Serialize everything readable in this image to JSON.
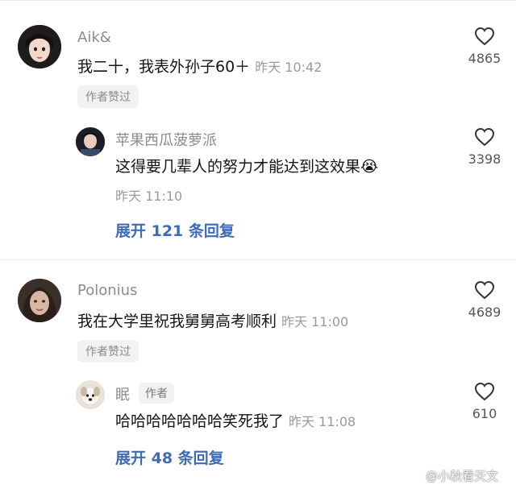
{
  "comments": [
    {
      "username": "Aik&",
      "text": "我二十，我表外孙子60＋",
      "time": "昨天 10:42",
      "author_liked": "作者赞过",
      "likes": "4865",
      "reply": {
        "username": "苹果西瓜菠萝派",
        "text": "这得要几辈人的努力才能达到这效果",
        "emoji": "😭",
        "time": "昨天 11:10",
        "likes": "3398"
      },
      "expand_label": "展开 121 条回复"
    },
    {
      "username": "Polonius",
      "text": "我在大学里祝我舅舅高考顺利",
      "time": "昨天 11:00",
      "author_liked": "作者赞过",
      "likes": "4689",
      "reply": {
        "username": "眠",
        "author_tag": "作者",
        "text": "哈哈哈哈哈哈哈笑死我了",
        "time": "昨天 11:08",
        "likes": "610"
      },
      "expand_label": "展开 48 条回复"
    }
  ],
  "watermark": "@小秋看天文",
  "colors": {
    "link": "#3f6bb5",
    "muted": "#9a9a9a"
  }
}
